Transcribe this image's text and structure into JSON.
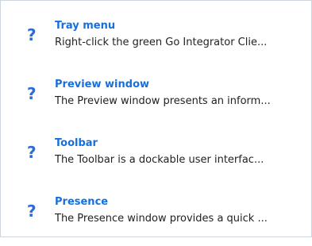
{
  "help_topics": [
    {
      "icon": "question-mark-icon",
      "title": "Tray menu",
      "description": "Right-click the green Go Integrator Clie..."
    },
    {
      "icon": "question-mark-icon",
      "title": "Preview window",
      "description": "The Preview window presents an inform..."
    },
    {
      "icon": "question-mark-icon",
      "title": "Toolbar",
      "description": "The Toolbar is a dockable user interfac..."
    },
    {
      "icon": "question-mark-icon",
      "title": "Presence",
      "description": "The Presence window provides a quick ..."
    }
  ],
  "colors": {
    "icon": "#2d6bd8",
    "title": "#1570de",
    "description": "#222222",
    "border": "#cfd5dc"
  }
}
